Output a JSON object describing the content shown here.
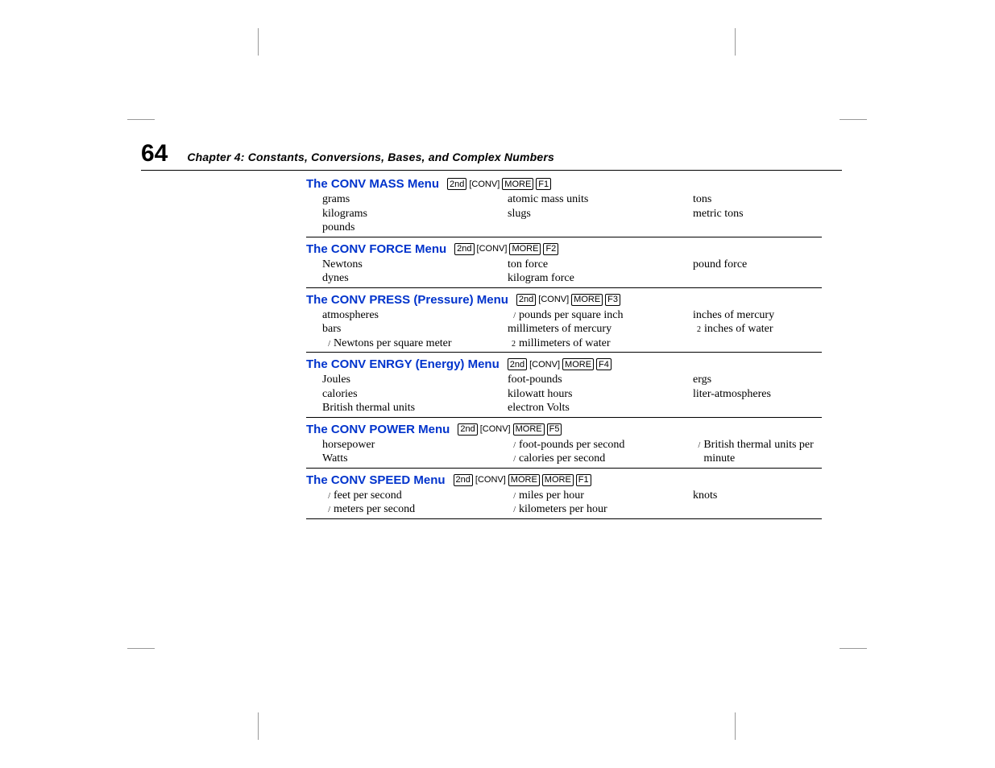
{
  "page_number": "64",
  "chapter_line": "Chapter 4:  Constants, Conversions, Bases, and Complex Numbers",
  "sections": [
    {
      "title": "The CONV MASS Menu",
      "keys": [
        "2nd",
        "[CONV]",
        "MORE",
        "F1"
      ],
      "cols": [
        [
          {
            "p": "",
            "t": "grams"
          },
          {
            "p": "",
            "t": "kilograms"
          },
          {
            "p": "",
            "t": "pounds"
          }
        ],
        [
          {
            "p": "",
            "t": "atomic mass units"
          },
          {
            "p": "",
            "t": "slugs"
          }
        ],
        [
          {
            "p": "",
            "t": "tons"
          },
          {
            "p": "",
            "t": "metric tons"
          }
        ]
      ]
    },
    {
      "title": "The CONV FORCE Menu",
      "keys": [
        "2nd",
        "[CONV]",
        "MORE",
        "F2"
      ],
      "cols": [
        [
          {
            "p": "",
            "t": "Newtons"
          },
          {
            "p": "",
            "t": "dynes"
          }
        ],
        [
          {
            "p": "",
            "t": "ton force"
          },
          {
            "p": "",
            "t": "kilogram force"
          }
        ],
        [
          {
            "p": "",
            "t": "pound force"
          }
        ]
      ]
    },
    {
      "title": "The CONV PRESS (Pressure) Menu",
      "keys": [
        "2nd",
        "[CONV]",
        "MORE",
        "F3"
      ],
      "cols": [
        [
          {
            "p": "",
            "t": "atmospheres"
          },
          {
            "p": "",
            "t": "bars"
          },
          {
            "p": "/",
            "t": "Newtons per square meter"
          }
        ],
        [
          {
            "p": "/",
            "t": "pounds per square inch"
          },
          {
            "p": "",
            "t": "millimeters of mercury"
          },
          {
            "p": "2",
            "t": "millimeters of water"
          }
        ],
        [
          {
            "p": "",
            "t": "inches of mercury"
          },
          {
            "p": "2",
            "t": "inches of water"
          }
        ]
      ]
    },
    {
      "title": "The CONV ENRGY (Energy) Menu",
      "keys": [
        "2nd",
        "[CONV]",
        "MORE",
        "F4"
      ],
      "cols": [
        [
          {
            "p": "",
            "t": "Joules"
          },
          {
            "p": "",
            "t": "calories"
          },
          {
            "p": "",
            "t": "British thermal units"
          }
        ],
        [
          {
            "p": "",
            "t": "foot-pounds"
          },
          {
            "p": "",
            "t": "kilowatt hours"
          },
          {
            "p": "",
            "t": "electron Volts"
          }
        ],
        [
          {
            "p": "",
            "t": "ergs"
          },
          {
            "p": "",
            "t": "liter-atmospheres"
          }
        ]
      ]
    },
    {
      "title": "The CONV POWER Menu",
      "keys": [
        "2nd",
        "[CONV]",
        "MORE",
        "F5"
      ],
      "cols": [
        [
          {
            "p": "",
            "t": "horsepower"
          },
          {
            "p": "",
            "t": "Watts"
          }
        ],
        [
          {
            "p": "/",
            "t": "foot-pounds per second"
          },
          {
            "p": "/",
            "t": "calories per second"
          }
        ],
        [
          {
            "p": "/",
            "t": "British thermal units per minute"
          }
        ]
      ]
    },
    {
      "title": "The CONV SPEED Menu",
      "keys": [
        "2nd",
        "[CONV]",
        "MORE",
        "MORE",
        "F1"
      ],
      "cols": [
        [
          {
            "p": "/",
            "t": "feet per second"
          },
          {
            "p": "/",
            "t": "meters per second"
          }
        ],
        [
          {
            "p": "/",
            "t": "miles per hour"
          },
          {
            "p": "/",
            "t": "kilometers per hour"
          }
        ],
        [
          {
            "p": "",
            "t": "knots"
          }
        ]
      ]
    }
  ]
}
